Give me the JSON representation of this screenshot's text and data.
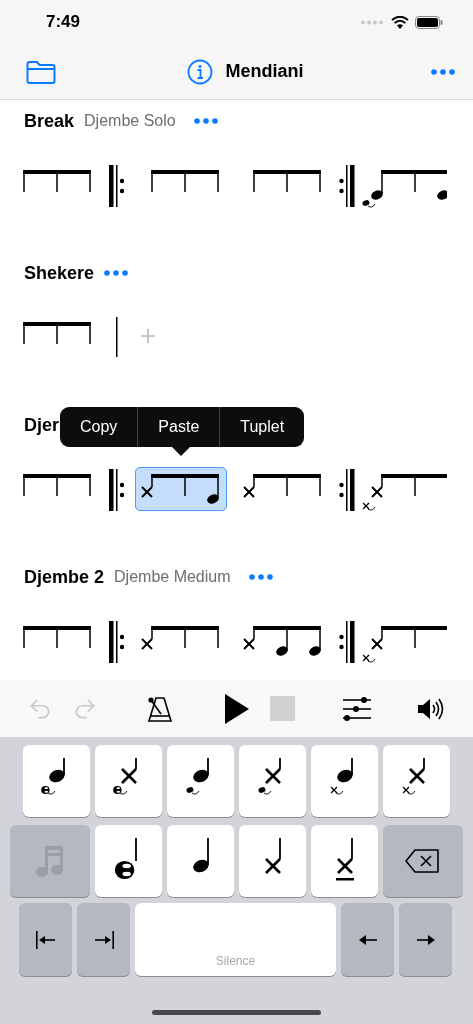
{
  "status_bar": {
    "time": "7:49"
  },
  "nav": {
    "title": "Mendiani"
  },
  "sections": [
    {
      "title": "Break",
      "subtitle": "Djembe Solo",
      "items": [
        {
          "kind": "group",
          "selected": false,
          "stems": [
            {
              "kind": "empty"
            },
            {
              "kind": "empty"
            },
            {
              "kind": "empty"
            }
          ]
        },
        {
          "kind": "repeat-start"
        },
        {
          "kind": "group",
          "selected": false,
          "stems": [
            {
              "kind": "empty"
            },
            {
              "kind": "empty"
            },
            {
              "kind": "empty"
            }
          ]
        },
        {
          "kind": "group",
          "selected": false,
          "stems": [
            {
              "kind": "empty"
            },
            {
              "kind": "empty"
            },
            {
              "kind": "empty"
            }
          ]
        },
        {
          "kind": "repeat-end"
        },
        {
          "kind": "group",
          "selected": false,
          "stems": [
            {
              "kind": "tone",
              "grace": {
                "kind": "tone"
              }
            },
            {
              "kind": "empty"
            },
            {
              "kind": "tone"
            }
          ]
        }
      ]
    },
    {
      "title": "Shekere",
      "items": [
        {
          "kind": "group",
          "selected": false,
          "stems": [
            {
              "kind": "empty"
            },
            {
              "kind": "empty"
            },
            {
              "kind": "empty"
            }
          ]
        },
        {
          "kind": "barline"
        },
        {
          "kind": "add"
        }
      ]
    },
    {
      "title": "Djer",
      "menu": [
        "Copy",
        "Paste",
        "Tuplet"
      ],
      "items": [
        {
          "kind": "group",
          "selected": false,
          "stems": [
            {
              "kind": "empty"
            },
            {
              "kind": "empty"
            },
            {
              "kind": "empty"
            }
          ]
        },
        {
          "kind": "repeat-start"
        },
        {
          "kind": "group",
          "selected": true,
          "stems": [
            {
              "kind": "slap"
            },
            {
              "kind": "empty"
            },
            {
              "kind": "tone"
            }
          ]
        },
        {
          "kind": "group",
          "selected": false,
          "stems": [
            {
              "kind": "slap"
            },
            {
              "kind": "empty"
            },
            {
              "kind": "empty"
            }
          ]
        },
        {
          "kind": "repeat-end"
        },
        {
          "kind": "group",
          "selected": false,
          "stems": [
            {
              "kind": "slap",
              "grace": {
                "kind": "slap"
              }
            },
            {
              "kind": "empty"
            },
            {
              "kind": "empty"
            }
          ]
        }
      ]
    },
    {
      "title": "Djembe 2",
      "subtitle": "Djembe Medium",
      "items": [
        {
          "kind": "group",
          "selected": false,
          "stems": [
            {
              "kind": "empty"
            },
            {
              "kind": "empty"
            },
            {
              "kind": "empty"
            }
          ]
        },
        {
          "kind": "repeat-start"
        },
        {
          "kind": "group",
          "selected": false,
          "stems": [
            {
              "kind": "slap"
            },
            {
              "kind": "empty"
            },
            {
              "kind": "empty"
            }
          ]
        },
        {
          "kind": "group",
          "selected": false,
          "stems": [
            {
              "kind": "slap"
            },
            {
              "kind": "tone"
            },
            {
              "kind": "tone"
            }
          ]
        },
        {
          "kind": "repeat-end"
        },
        {
          "kind": "group",
          "selected": false,
          "stems": [
            {
              "kind": "slap",
              "grace": {
                "kind": "slap"
              }
            },
            {
              "kind": "empty"
            },
            {
              "kind": "empty"
            }
          ]
        }
      ]
    }
  ],
  "toolbar": [
    {
      "kind": "undo",
      "disabled": true
    },
    {
      "kind": "redo",
      "disabled": true
    },
    {
      "kind": "metronome",
      "disabled": false
    },
    {
      "kind": "play",
      "disabled": false
    },
    {
      "kind": "stop",
      "disabled": true
    },
    {
      "kind": "mixer",
      "disabled": false
    },
    {
      "kind": "volume",
      "disabled": false
    }
  ],
  "keyboard": {
    "rows": [
      [
        {
          "kind": "note",
          "head": {
            "kind": "tone"
          },
          "grace": {
            "kind": "bass"
          }
        },
        {
          "kind": "note",
          "head": {
            "kind": "slap"
          },
          "grace": {
            "kind": "bass"
          }
        },
        {
          "kind": "note",
          "head": {
            "kind": "tone"
          },
          "grace": {
            "kind": "tone"
          }
        },
        {
          "kind": "note",
          "head": {
            "kind": "slap"
          },
          "grace": {
            "kind": "tone"
          }
        },
        {
          "kind": "note",
          "head": {
            "kind": "tone"
          },
          "grace": {
            "kind": "slap"
          }
        },
        {
          "kind": "note",
          "head": {
            "kind": "slap"
          },
          "grace": {
            "kind": "slap"
          }
        }
      ],
      [
        {
          "kind": "mode",
          "disabled": true
        },
        {
          "kind": "note",
          "head": {
            "kind": "bass"
          },
          "muted": false
        },
        {
          "kind": "note",
          "head": {
            "kind": "tone"
          },
          "muted": false
        },
        {
          "kind": "note",
          "head": {
            "kind": "slap"
          },
          "muted": false
        },
        {
          "kind": "note",
          "head": {
            "kind": "slap"
          },
          "muted": true
        },
        {
          "kind": "delete"
        }
      ],
      [
        {
          "kind": "start"
        },
        {
          "kind": "end"
        },
        {
          "kind": "space",
          "label": "Silence"
        },
        {
          "kind": "left"
        },
        {
          "kind": "right"
        }
      ]
    ]
  }
}
